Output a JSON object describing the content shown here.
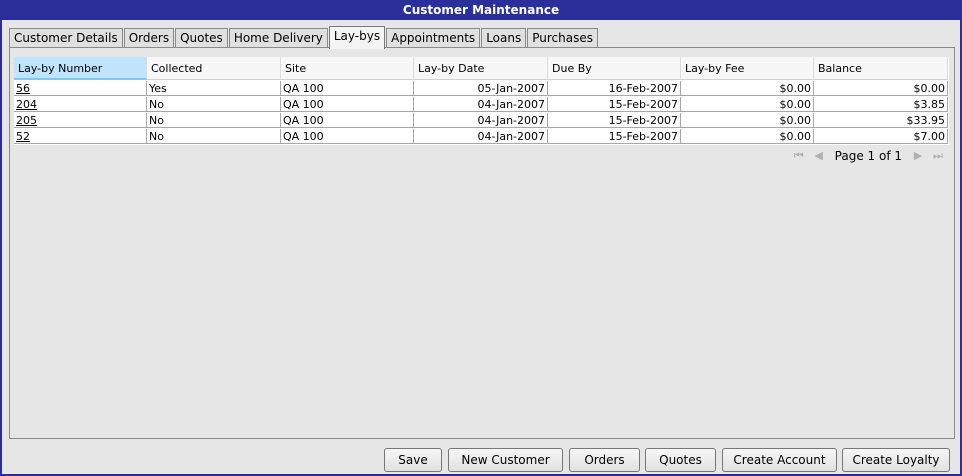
{
  "window": {
    "title": "Customer Maintenance"
  },
  "tabs": [
    {
      "label": "Customer Details",
      "active": false
    },
    {
      "label": "Orders",
      "active": false
    },
    {
      "label": "Quotes",
      "active": false
    },
    {
      "label": "Home Delivery",
      "active": false
    },
    {
      "label": "Lay-bys",
      "active": true
    },
    {
      "label": "Appointments",
      "active": false
    },
    {
      "label": "Loans",
      "active": false
    },
    {
      "label": "Purchases",
      "active": false
    }
  ],
  "grid": {
    "columns": [
      "Lay-by Number",
      "Collected",
      "Site",
      "Lay-by Date",
      "Due By",
      "Lay-by Fee",
      "Balance"
    ],
    "sorted_column": "Lay-by Number",
    "rows": [
      [
        "56",
        "Yes",
        "QA 100",
        "05-Jan-2007",
        "16-Feb-2007",
        "$0.00",
        "$0.00"
      ],
      [
        "204",
        "No",
        "QA 100",
        "04-Jan-2007",
        "15-Feb-2007",
        "$0.00",
        "$3.85"
      ],
      [
        "205",
        "No",
        "QA 100",
        "04-Jan-2007",
        "15-Feb-2007",
        "$0.00",
        "$33.95"
      ],
      [
        "52",
        "No",
        "QA 100",
        "04-Jan-2007",
        "15-Feb-2007",
        "$0.00",
        "$7.00"
      ]
    ]
  },
  "pager": {
    "label": "Page 1 of 1",
    "icons": [
      "first-page-icon",
      "previous-page-icon",
      "next-page-icon",
      "last-page-icon"
    ]
  },
  "buttons": {
    "save": "Save",
    "new_customer": "New Customer",
    "orders": "Orders",
    "quotes": "Quotes",
    "create_account": "Create Account",
    "create_loyalty": "Create Loyalty"
  }
}
